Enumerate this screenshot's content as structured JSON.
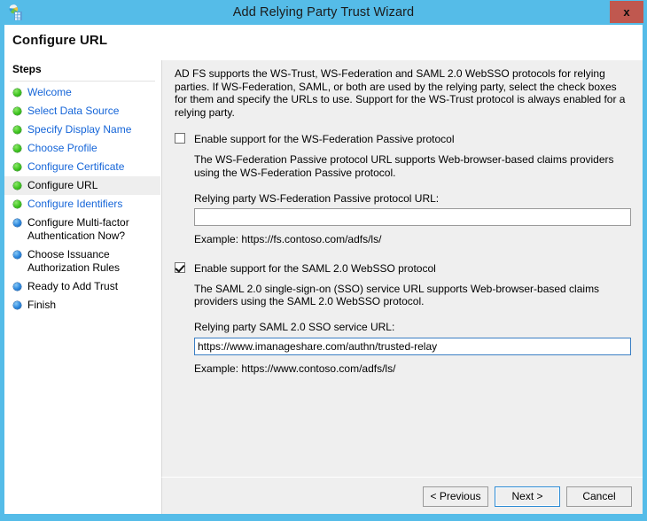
{
  "window": {
    "title": "Add Relying Party Trust Wizard",
    "close_label": "x",
    "app_icon": "adfs-wizard-icon",
    "titlebar_color": "#55bce8",
    "close_button_color": "#c0584f"
  },
  "header": {
    "page_title": "Configure URL"
  },
  "sidebar": {
    "heading": "Steps",
    "items": [
      {
        "label": "Welcome",
        "state": "done"
      },
      {
        "label": "Select Data Source",
        "state": "done"
      },
      {
        "label": "Specify Display Name",
        "state": "done"
      },
      {
        "label": "Choose Profile",
        "state": "done"
      },
      {
        "label": "Configure Certificate",
        "state": "done"
      },
      {
        "label": "Configure URL",
        "state": "current"
      },
      {
        "label": "Configure Identifiers",
        "state": "done"
      },
      {
        "label": "Configure Multi-factor Authentication Now?",
        "state": "future"
      },
      {
        "label": "Choose Issuance Authorization Rules",
        "state": "future"
      },
      {
        "label": "Ready to Add Trust",
        "state": "future"
      },
      {
        "label": "Finish",
        "state": "future"
      }
    ]
  },
  "main": {
    "intro": "AD FS supports the WS-Trust, WS-Federation and SAML 2.0 WebSSO protocols for relying parties.  If WS-Federation, SAML, or both are used by the relying party, select the check boxes for them and specify the URLs to use.  Support for the WS-Trust protocol is always enabled for a relying party.",
    "wsfed": {
      "checkbox_label": "Enable support for the WS-Federation Passive protocol",
      "checked": false,
      "description": "The WS-Federation Passive protocol URL supports Web-browser-based claims providers using the WS-Federation Passive protocol.",
      "field_label": "Relying party WS-Federation Passive protocol URL:",
      "value": "",
      "example": "Example: https://fs.contoso.com/adfs/ls/"
    },
    "saml": {
      "checkbox_label": "Enable support for the SAML 2.0 WebSSO protocol",
      "checked": true,
      "description": "The SAML 2.0 single-sign-on (SSO) service URL supports Web-browser-based claims providers using the SAML 2.0 WebSSO protocol.",
      "field_label": "Relying party SAML 2.0 SSO service URL:",
      "value": "https://www.imanageshare.com/authn/trusted-relay",
      "example": "Example: https://www.contoso.com/adfs/ls/"
    }
  },
  "buttons": {
    "previous": "< Previous",
    "next": "Next >",
    "cancel": "Cancel"
  }
}
